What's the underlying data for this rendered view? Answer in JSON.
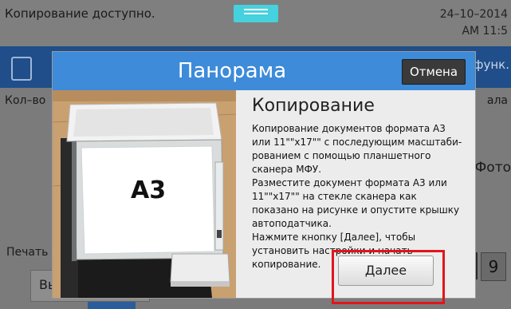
{
  "status": {
    "message": "Копирование доступно.",
    "date": "24–10–2014",
    "time": "AM 11:5"
  },
  "background": {
    "qty_label": "Кол–во",
    "right_label": "ала",
    "func_label": "функ.",
    "photo_label": "Фото",
    "print_label": "Печать",
    "field_value": "Вы",
    "num_value": "9"
  },
  "dialog": {
    "title": "Панорама",
    "cancel_label": "Отмена",
    "heading": "Копирование",
    "body": [
      "Копирование документов формата А3 или 11\"\"x17\"\" с последующим масштаби-рованием с помощью планшетного сканера МФУ.",
      "Разместите документ формата А3 или 11\"\"x17\"\" на стекле сканера как показано на рисунке и опустите крышку автоподатчика.",
      "Нажмите кнопку [Далее], чтобы установить настройки и начать копирование."
    ],
    "next_label": "Далее",
    "doc_label": "А3"
  },
  "colors": {
    "header_blue": "#3d8bd9",
    "nav_blue": "#1f4e8a",
    "handle_cyan": "#45d1dd",
    "highlight_red": "#e0161b"
  }
}
